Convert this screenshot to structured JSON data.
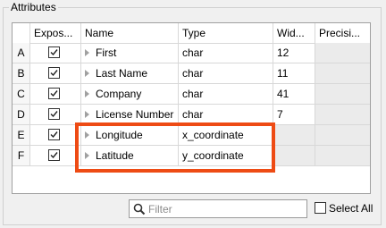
{
  "attributes": {
    "title": "Attributes",
    "columns": [
      "Expos...",
      "Name",
      "Type",
      "Wid...",
      "Precisi..."
    ],
    "rows": [
      {
        "id": "A",
        "exposed": true,
        "name": "First",
        "type": "char",
        "width": "12",
        "precision": ""
      },
      {
        "id": "B",
        "exposed": true,
        "name": "Last Name",
        "type": "char",
        "width": "11",
        "precision": ""
      },
      {
        "id": "C",
        "exposed": true,
        "name": "Company",
        "type": "char",
        "width": "41",
        "precision": ""
      },
      {
        "id": "D",
        "exposed": true,
        "name": "License Number",
        "type": "char",
        "width": "7",
        "precision": ""
      },
      {
        "id": "E",
        "exposed": true,
        "name": "Longitude",
        "type": "x_coordinate",
        "width": "",
        "precision": ""
      },
      {
        "id": "F",
        "exposed": true,
        "name": "Latitude",
        "type": "y_coordinate",
        "width": "",
        "precision": ""
      }
    ]
  },
  "filter": {
    "placeholder": "Filter",
    "value": ""
  },
  "select_all": {
    "label": "Select All",
    "checked": false
  },
  "colors": {
    "highlight": "#ee4b14",
    "gray_cell": "#ebebeb"
  },
  "icons": {
    "filter": "search-icon",
    "expander": "triangle-right-icon",
    "check": "checkmark-icon"
  }
}
